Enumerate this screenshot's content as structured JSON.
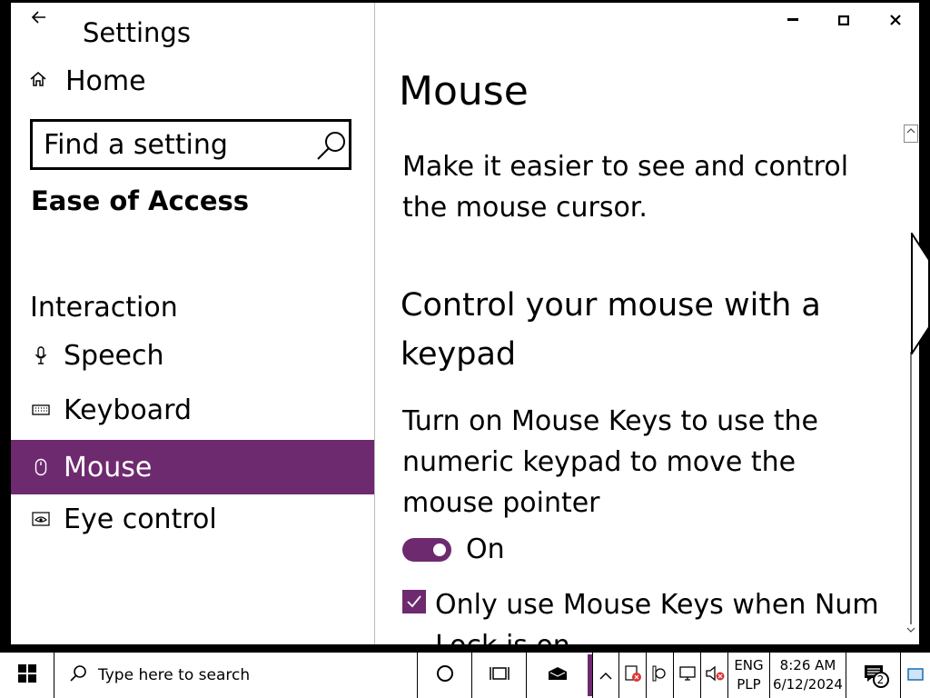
{
  "window": {
    "app_title": "Settings",
    "back_icon": "back-arrow-icon",
    "minimize_glyph": "▬",
    "maximize_glyph": "▢",
    "close_glyph": "✕"
  },
  "sidebar": {
    "home_label": "Home",
    "search_placeholder": "Find a setting",
    "section_title": "Ease of Access",
    "group_title": "Interaction",
    "items": [
      {
        "label": "Speech",
        "icon": "microphone-icon",
        "selected": false
      },
      {
        "label": "Keyboard",
        "icon": "keyboard-icon",
        "selected": false
      },
      {
        "label": "Mouse",
        "icon": "mouse-icon",
        "selected": true
      },
      {
        "label": "Eye control",
        "icon": "eye-icon",
        "selected": false
      }
    ]
  },
  "main": {
    "title": "Mouse",
    "description": "Make it easier to see and control the mouse cursor.",
    "subheading": "Control your mouse with a keypad",
    "mouse_keys_text": "Turn on Mouse Keys to use the numeric keypad to move the mouse pointer",
    "toggle_state": "On",
    "checkbox_label": "Only use Mouse Keys when Num Lock is on"
  },
  "taskbar": {
    "search_placeholder": "Type here to search",
    "language_top": "ENG",
    "language_bottom": "PLP",
    "time": "8:26 AM",
    "date": "6/12/2024",
    "notification_count": "2"
  },
  "colors": {
    "accent": "#6e2a6f"
  }
}
